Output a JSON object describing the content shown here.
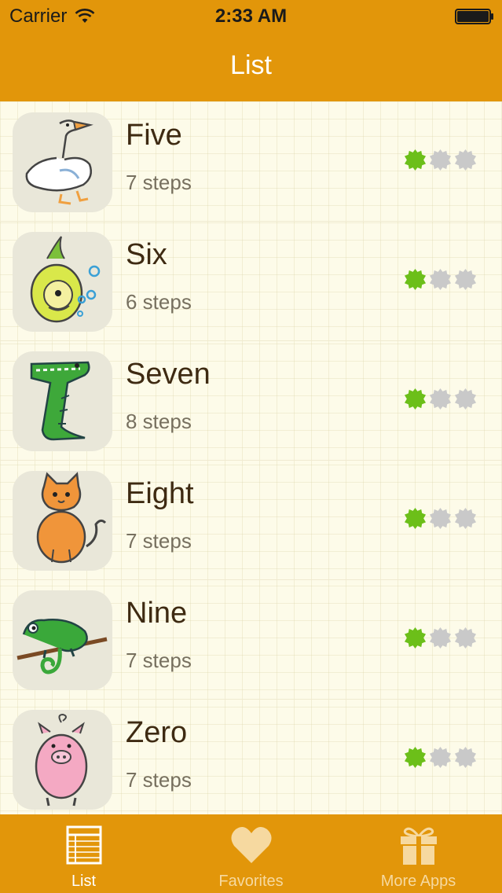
{
  "status_bar": {
    "carrier": "Carrier",
    "time": "2:33 AM",
    "icons": [
      "wifi-icon",
      "battery-icon"
    ]
  },
  "nav": {
    "title": "List"
  },
  "colors": {
    "header": "#e2960a",
    "background": "#fdfbe9",
    "title_text": "#3e2a12",
    "subtitle_text": "#77705f",
    "badge_done": "#6cbf19",
    "badge_todo": "#c9c9c9",
    "tab_active": "#ffffff",
    "tab_inactive": "#f6d9a0"
  },
  "items": [
    {
      "title": "Five",
      "steps": "7 steps",
      "icon": "goose-icon",
      "badges": [
        true,
        false,
        false
      ]
    },
    {
      "title": "Six",
      "steps": "6 steps",
      "icon": "fish-icon",
      "badges": [
        true,
        false,
        false
      ]
    },
    {
      "title": "Seven",
      "steps": "8 steps",
      "icon": "crocodile-icon",
      "badges": [
        true,
        false,
        false
      ]
    },
    {
      "title": "Eight",
      "steps": "7 steps",
      "icon": "cat-icon",
      "badges": [
        true,
        false,
        false
      ]
    },
    {
      "title": "Nine",
      "steps": "7 steps",
      "icon": "chameleon-icon",
      "badges": [
        true,
        false,
        false
      ]
    },
    {
      "title": "Zero",
      "steps": "7 steps",
      "icon": "pig-icon",
      "badges": [
        true,
        false,
        false
      ]
    }
  ],
  "tabs": [
    {
      "label": "List",
      "icon": "list-icon",
      "active": true
    },
    {
      "label": "Favorites",
      "icon": "heart-icon",
      "active": false
    },
    {
      "label": "More Apps",
      "icon": "gift-icon",
      "active": false
    }
  ]
}
